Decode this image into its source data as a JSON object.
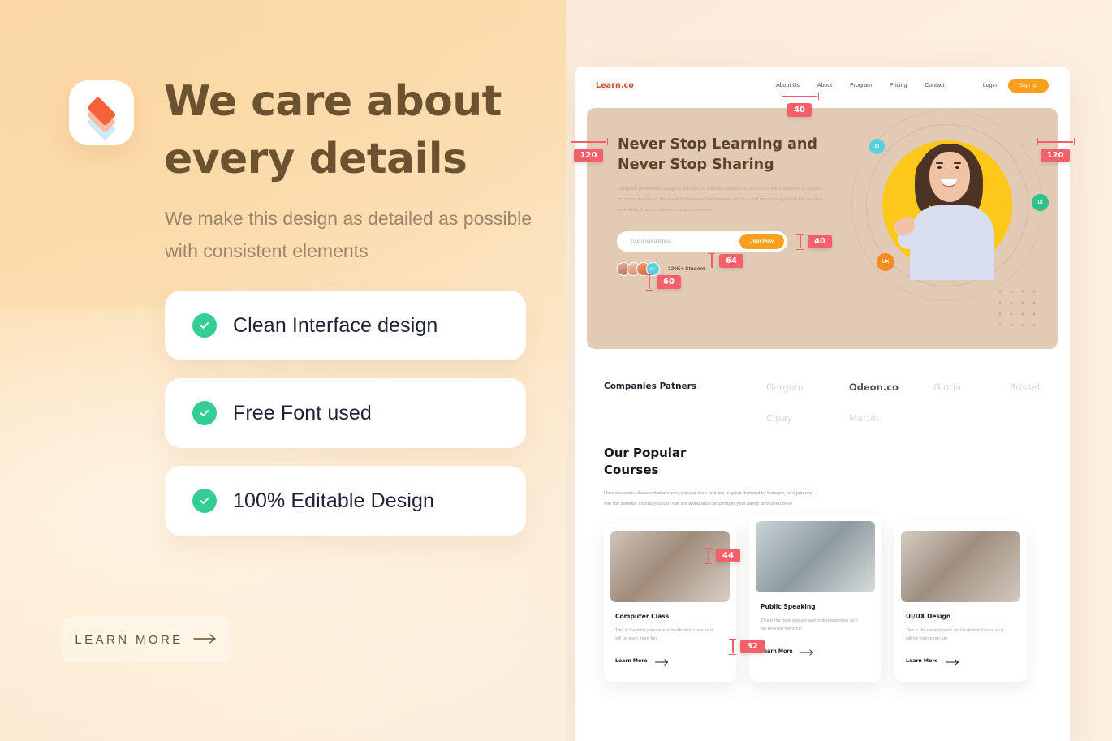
{
  "promo": {
    "logo_icon": "layers-stack-icon",
    "headline": "We care about every details",
    "subcopy": "We make this design as detailed as possible with consistent elements",
    "features": [
      {
        "label": "Clean Interface design",
        "icon": "check-circle-icon"
      },
      {
        "label": "Free Font used",
        "icon": "check-circle-icon"
      },
      {
        "label": "100% Editable Design",
        "icon": "check-circle-icon"
      }
    ],
    "cta": {
      "label": "LEARN MORE",
      "icon": "arrow-right-icon"
    },
    "colors": {
      "background_top": "#FAD7A4",
      "background_bottom": "#FCEFDD",
      "headline": "#6B5231",
      "subcopy": "#9C8469",
      "check": "#34CE95",
      "accent_orange": "#F4623A"
    }
  },
  "preview": {
    "nav": {
      "logo": "Learn.co",
      "links": [
        "About Us",
        "About",
        "Program",
        "Pricing",
        "Contact"
      ],
      "login": "Login",
      "signup": "Sign up"
    },
    "hero": {
      "title": "Never Stop Learning and Never Stop Sharing",
      "paragraph": "Relatively permanent change in behavior or potential behavior as a result of the experience or practice occurring learning is the result of the interaction between stimulus and response a person has learned something if he can show a change in behavior.",
      "email_placeholder": "Your email address",
      "email_value": "",
      "cta": "Join Now",
      "avatar_more": "10+",
      "students": "120K+ Student",
      "badges": [
        "ID",
        "UI",
        "UX"
      ],
      "badge_colors": {
        "id": "#57CFE0",
        "ui": "#2FC08B",
        "ux": "#F58C1F"
      },
      "background": "#E2CBB5",
      "circle_color": "#FDC81A"
    },
    "partners": {
      "title": "Companies Patners",
      "logos": [
        {
          "name": "Gorgom",
          "highlight": false
        },
        {
          "name": "Odeon.co",
          "highlight": true
        },
        {
          "name": "Gloria",
          "highlight": false
        },
        {
          "name": "Russell",
          "highlight": false
        },
        {
          "name": "Cipay",
          "highlight": false
        },
        {
          "name": "Martin",
          "highlight": false
        }
      ]
    },
    "courses": {
      "title": "Our Popular Courses",
      "description": "Here are some classes that are very popular here and are in great demand by humans, let's join and feel the benefits so that you can rule the world and can prosper your family and loved ones",
      "cards": [
        {
          "name": "Computer Class",
          "description": "This is the most popular and in-demand class so it will be even more fun",
          "link": "Learn More"
        },
        {
          "name": "Public Speaking",
          "description": "This is the most popular and in-demand class so it will be even more fun",
          "link": "Learn More"
        },
        {
          "name": "UI/UX Design",
          "description": "This is the most popular and in-demand class so it will be even more fun",
          "link": "Learn More"
        }
      ]
    }
  },
  "annotations": {
    "badge_color": "#F4606A",
    "values": {
      "nav_gap": "40",
      "hero_left": "120",
      "hero_right": "120",
      "hero_cta_gap": "40",
      "input_height": "64",
      "social_gap": "60",
      "cards_gap": "44",
      "card_text_gap": "32"
    }
  }
}
